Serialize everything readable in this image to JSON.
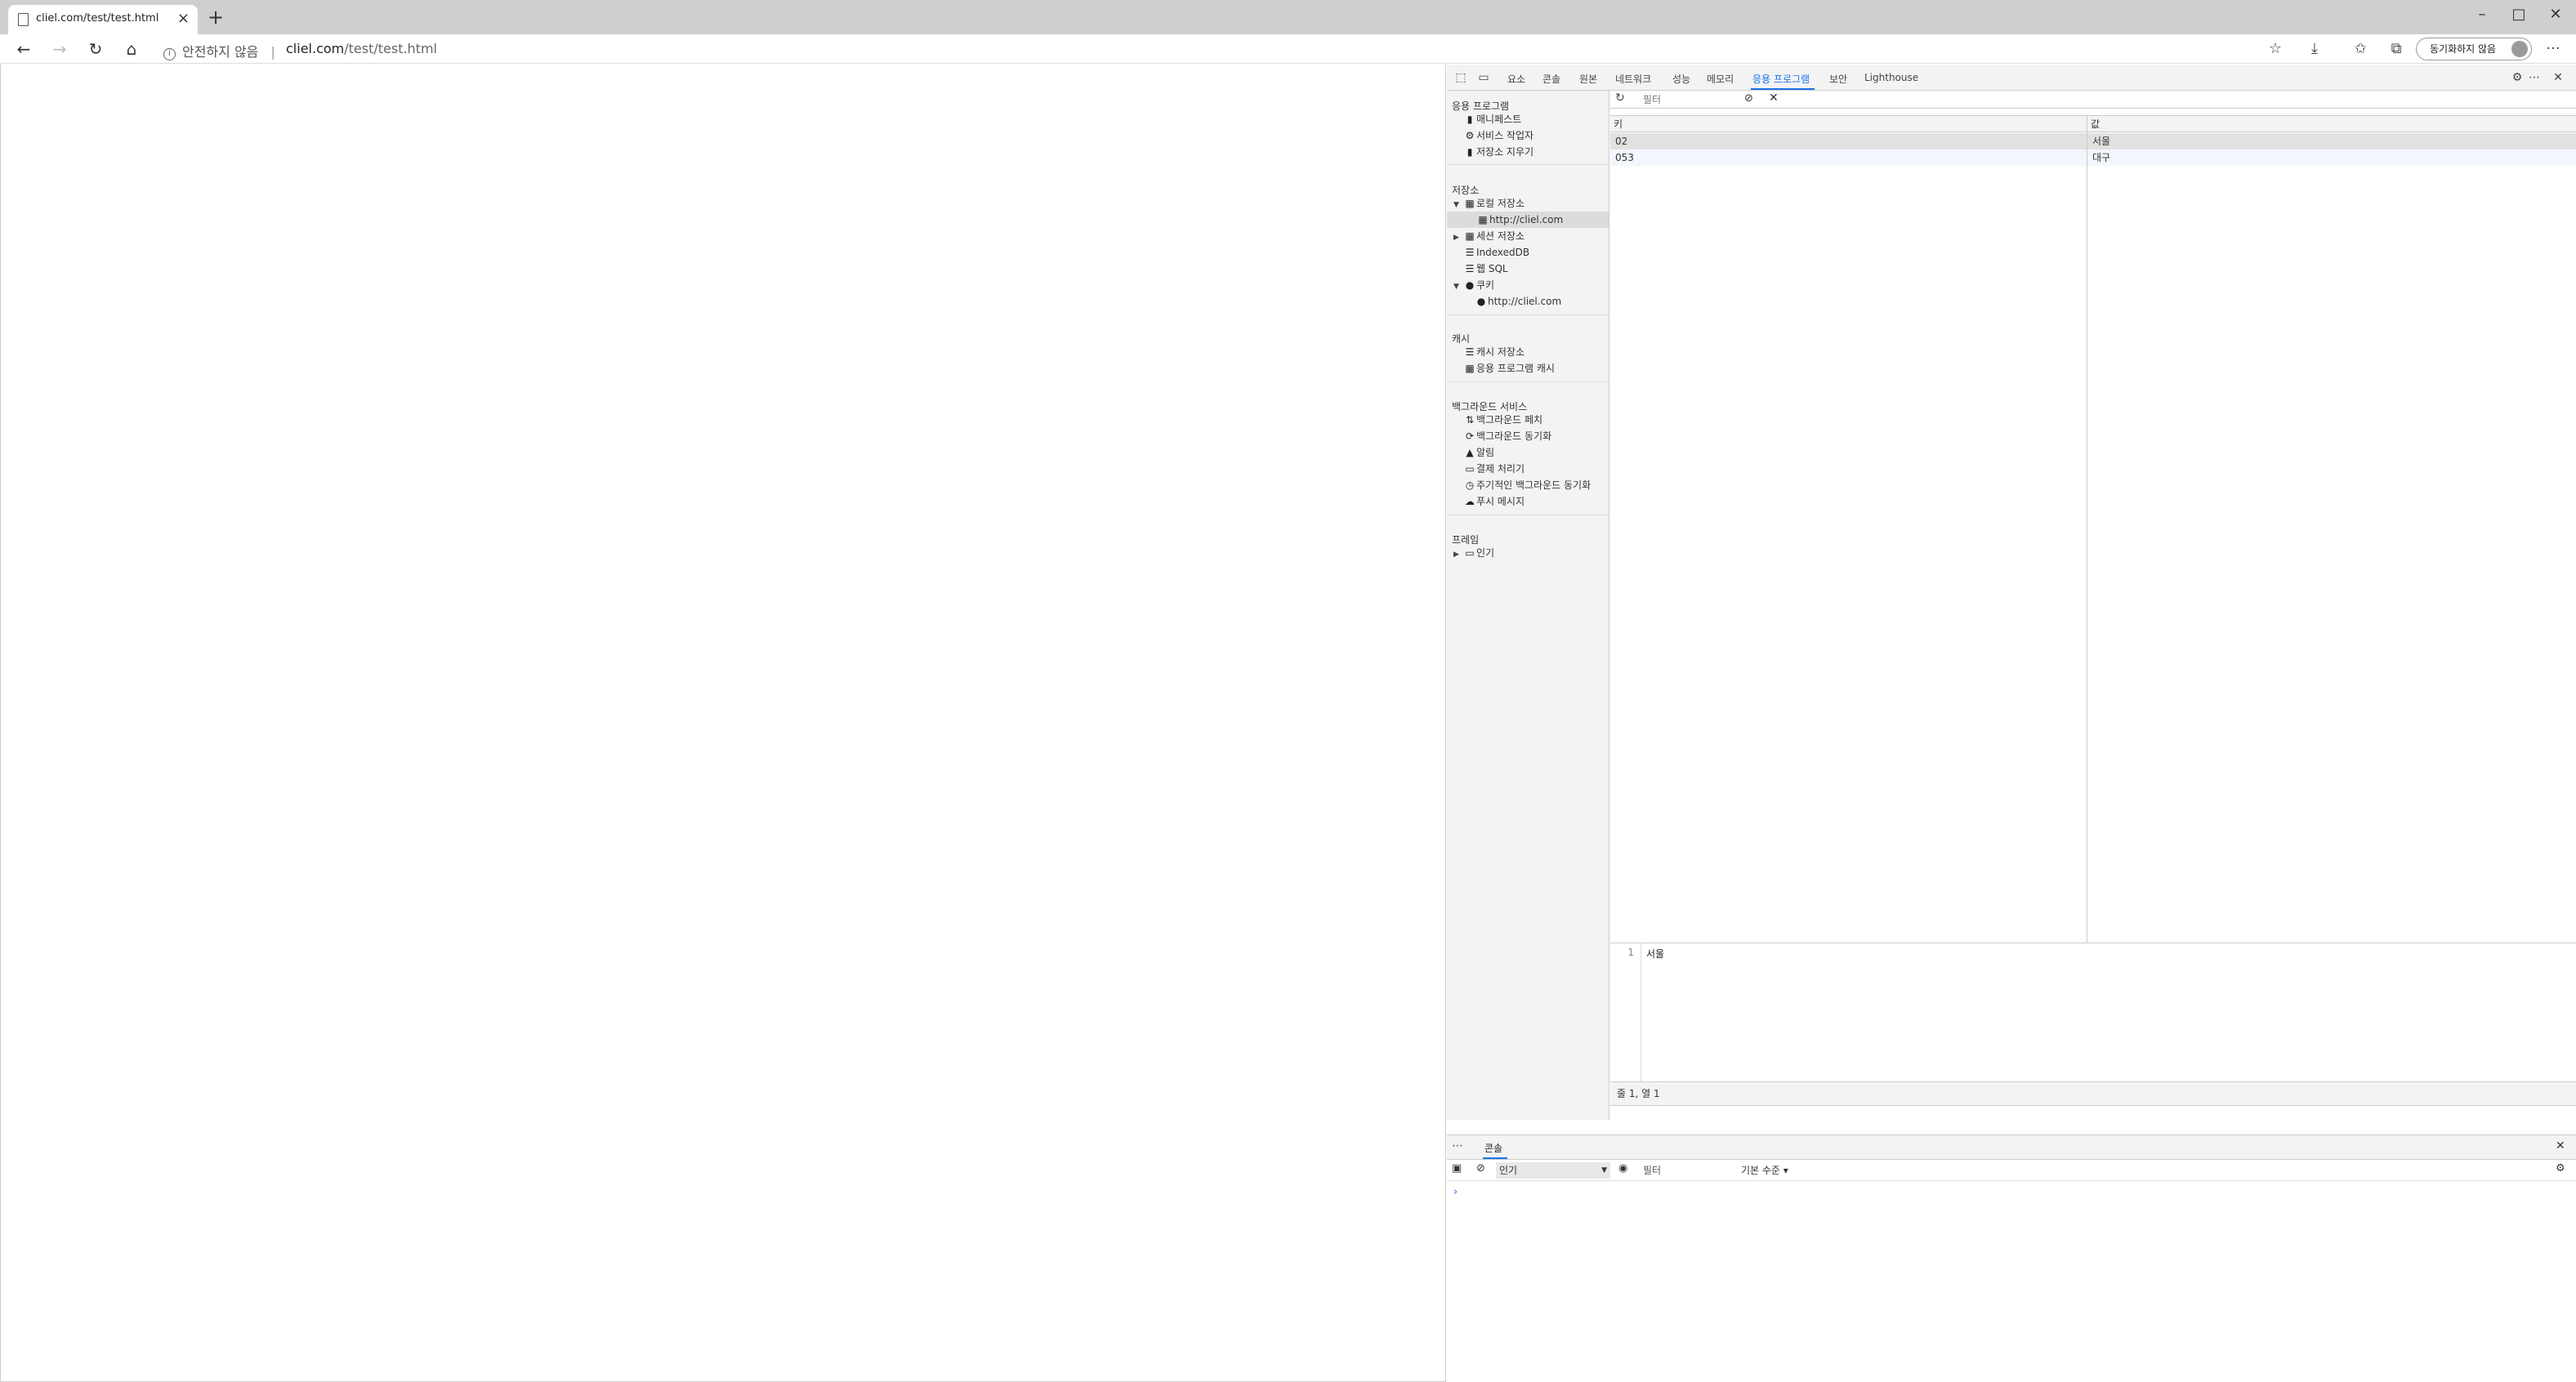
{
  "browser": {
    "tab_title": "cliel.com/test/test.html",
    "new_tab": "+",
    "security_label": "안전하지 않음",
    "separator": "|",
    "url_host": "cliel.com",
    "url_path": "/test/test.html",
    "sync_label": "동기화하지 않음",
    "more": "···"
  },
  "devtools": {
    "tabs": [
      "요소",
      "콘솔",
      "원본",
      "네트워크",
      "성능",
      "메모리",
      "응용 프로그램",
      "보안",
      "Lighthouse"
    ],
    "active_tab": "응용 프로그램",
    "sidebar": {
      "app_section": "응용 프로그램",
      "app_items": [
        "매니페스트",
        "서비스 작업자",
        "저장소 지우기"
      ],
      "storage_section": "저장소",
      "local_storage": "로컬 저장소",
      "local_origin": "http://cliel.com",
      "session_storage": "세션 저장소",
      "indexeddb": "IndexedDB",
      "websql": "웹 SQL",
      "cookies": "쿠키",
      "cookie_origin": "http://cliel.com",
      "cache_section": "캐시",
      "cache_items": [
        "캐시 저장소",
        "응용 프로그램 캐시"
      ],
      "bg_section": "백그라운드 서비스",
      "bg_items": [
        "백그라운드 페치",
        "백그라운드 동기화",
        "알림",
        "결제 처리기",
        "주기적인 백그라운드 동기화",
        "푸시 메시지"
      ],
      "frames_section": "프레임",
      "frames_top": "인기"
    },
    "storage_table": {
      "filter_placeholder": "필터",
      "col_key": "키",
      "col_value": "값",
      "rows": [
        {
          "key": "02",
          "value": "서울"
        },
        {
          "key": "053",
          "value": "대구"
        }
      ]
    },
    "preview": {
      "line_number": "1",
      "text": "서울"
    },
    "status": "줄 1, 열 1",
    "drawer": {
      "tab": "콘솔",
      "context": "인기",
      "filter_placeholder": "필터",
      "level": "기본 수준 ▾",
      "prompt": "›"
    }
  }
}
